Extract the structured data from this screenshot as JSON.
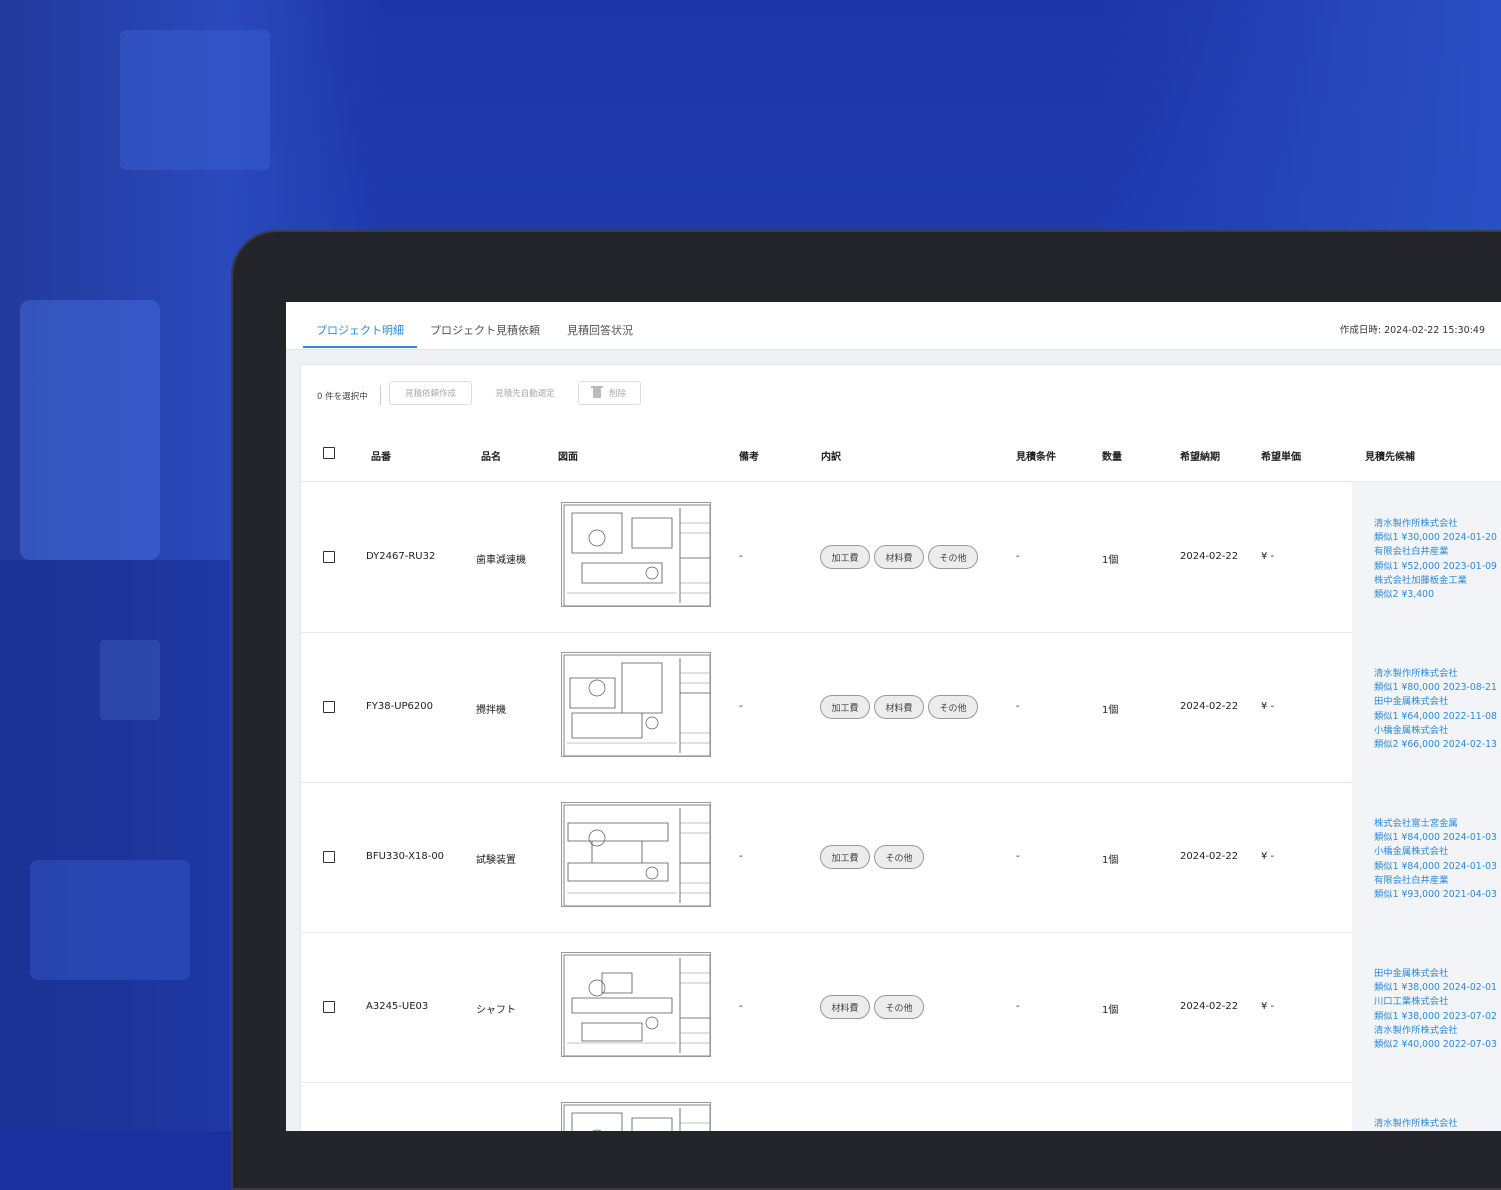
{
  "colors": {
    "accent": "#2d8ad8",
    "background_blue": "#1c2f9e",
    "bezel": "#23252a"
  },
  "tabs": [
    {
      "label": "プロジェクト明細",
      "active": true
    },
    {
      "label": "プロジェクト見積依頼",
      "active": false
    },
    {
      "label": "見積回答状況",
      "active": false
    }
  ],
  "created_at": "作成日時: 2024-02-22 15:30:49",
  "toolbar": {
    "selection_count": "0 件を選択中",
    "create_request_label": "見積依頼作成",
    "auto_select_label": "見積先自動選定",
    "delete_label": "削除"
  },
  "columns": {
    "part_no": "品番",
    "part_name": "品名",
    "drawing": "図面",
    "remarks": "備考",
    "breakdown": "内訳",
    "conditions": "見積条件",
    "quantity": "数量",
    "delivery": "希望納期",
    "unit_price": "希望単価",
    "vendors": "見積先候補"
  },
  "rows": [
    {
      "part_no": "DY2467-RU32",
      "part_name": "歯車減速機",
      "remarks": "-",
      "chips": [
        "加工費",
        "材料費",
        "その他"
      ],
      "conditions": "-",
      "quantity": "1個",
      "delivery": "2024-02-22",
      "unit_price": "¥ -",
      "vendors": [
        "清水製作所株式会社",
        "類似1  ¥30,000  2024-01-20",
        "有限会社白井産業",
        "類似1  ¥52,000  2023-01-09",
        "株式会社加藤板金工業",
        "類似2  ¥3,400"
      ]
    },
    {
      "part_no": "FY38-UP6200",
      "part_name": "攪拌機",
      "remarks": "-",
      "chips": [
        "加工費",
        "材料費",
        "その他"
      ],
      "conditions": "-",
      "quantity": "1個",
      "delivery": "2024-02-22",
      "unit_price": "¥ -",
      "vendors": [
        "清水製作所株式会社",
        "類似1  ¥80,000  2023-08-21",
        "田中金属株式会社",
        "類似1  ¥64,000  2022-11-08",
        "小橋金属株式会社",
        "類似2  ¥66,000  2024-02-13"
      ]
    },
    {
      "part_no": "BFU330-X18-00",
      "part_name": "試験装置",
      "remarks": "-",
      "chips": [
        "加工費",
        "その他"
      ],
      "conditions": "-",
      "quantity": "1個",
      "delivery": "2024-02-22",
      "unit_price": "¥ -",
      "vendors": [
        "株式会社富士宮金属",
        "類似1  ¥84,000  2024-01-03",
        "小橋金属株式会社",
        "類似1  ¥84,000  2024-01-03",
        "有限会社白井産業",
        "類似1  ¥93,000  2021-04-03"
      ]
    },
    {
      "part_no": "A3245-UE03",
      "part_name": "シャフト",
      "remarks": "-",
      "chips": [
        "材料費",
        "その他"
      ],
      "conditions": "-",
      "quantity": "1個",
      "delivery": "2024-02-22",
      "unit_price": "¥ -",
      "vendors": [
        "田中金属株式会社",
        "類似1  ¥38,000  2024-02-01",
        "川口工業株式会社",
        "類似1  ¥38,000  2023-07-02",
        "清水製作所株式会社",
        "類似2  ¥40,000  2022-07-03"
      ]
    },
    {
      "part_no": "",
      "part_name": "",
      "remarks": "",
      "chips": [],
      "conditions": "",
      "quantity": "",
      "delivery": "",
      "unit_price": "",
      "vendors": [
        "清水製作所株式会社"
      ]
    }
  ]
}
